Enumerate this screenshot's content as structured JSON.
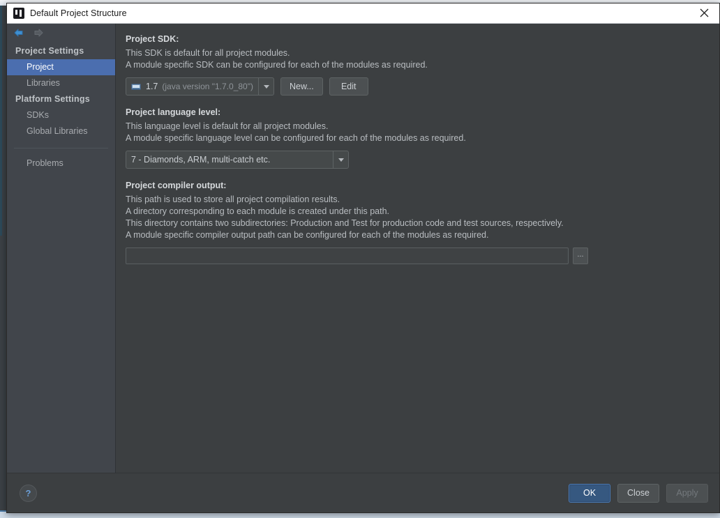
{
  "window": {
    "title": "Default Project Structure",
    "app_icon": "intellij-idea-icon",
    "close_label": "✕"
  },
  "sidebar": {
    "nav": {
      "back_icon": "arrow-left-icon",
      "forward_icon": "arrow-right-icon"
    },
    "groups": [
      {
        "header": "Project Settings",
        "items": [
          {
            "label": "Project",
            "selected": true
          },
          {
            "label": "Libraries",
            "selected": false
          }
        ]
      },
      {
        "header": "Platform Settings",
        "items": [
          {
            "label": "SDKs",
            "selected": false
          },
          {
            "label": "Global Libraries",
            "selected": false
          }
        ]
      }
    ],
    "extra_items": [
      {
        "label": "Problems",
        "selected": false
      }
    ]
  },
  "main": {
    "sdk_section": {
      "title": "Project SDK:",
      "description_lines": [
        "This SDK is default for all project modules.",
        "A module specific SDK can be configured for each of the modules as required."
      ],
      "combo": {
        "icon": "java-sdk-icon",
        "value_main": "1.7",
        "value_sub": "(java version \"1.7.0_80\")",
        "arrow_icon": "chevron-down-icon"
      },
      "new_button": "New...",
      "edit_button": "Edit"
    },
    "language_level_section": {
      "title": "Project language level:",
      "description_lines": [
        "This language level is default for all project modules.",
        "A module specific language level can be configured for each of the modules as required."
      ],
      "combo": {
        "value": "7 - Diamonds, ARM, multi-catch etc.",
        "arrow_icon": "chevron-down-icon"
      }
    },
    "compiler_output_section": {
      "title": "Project compiler output:",
      "description_lines": [
        "This path is used to store all project compilation results.",
        "A directory corresponding to each module is created under this path.",
        "This directory contains two subdirectories: Production and Test for production code and test sources, respectively.",
        "A module specific compiler output path can be configured for each of the modules as required."
      ],
      "field_value": "",
      "field_placeholder": "",
      "browse_button": "..."
    }
  },
  "footer": {
    "help_icon": "question-mark-icon",
    "buttons": [
      {
        "label": "OK",
        "style": "primary",
        "disabled": false
      },
      {
        "label": "Close",
        "style": "normal",
        "disabled": false
      },
      {
        "label": "Apply",
        "style": "normal",
        "disabled": true
      }
    ]
  },
  "colors": {
    "panel_bg": "#3c3f41",
    "sidebar_bg": "#41454b",
    "selection_blue": "#4b6eaf",
    "primary_button": "#365880",
    "titlebar_bg": "#ffffff",
    "text_primary": "#d6d9dc",
    "text_secondary": "#b9bdc1",
    "text_dim": "#8f9499"
  }
}
